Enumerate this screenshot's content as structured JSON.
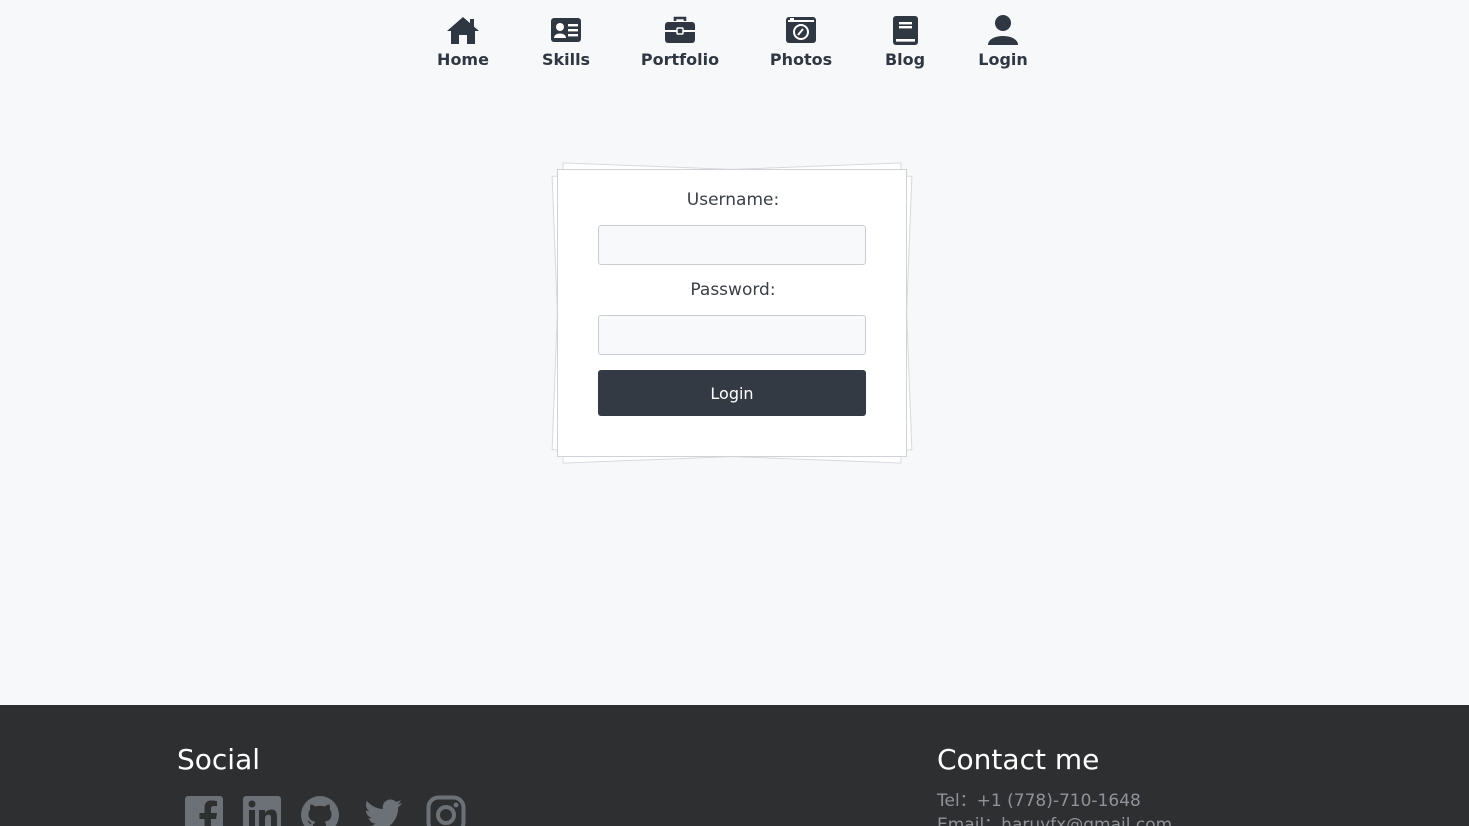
{
  "nav": {
    "items": [
      {
        "label": "Home",
        "icon": "home-icon"
      },
      {
        "label": "Skills",
        "icon": "id-card-icon"
      },
      {
        "label": "Portfolio",
        "icon": "briefcase-icon"
      },
      {
        "label": "Photos",
        "icon": "camera-icon"
      },
      {
        "label": "Blog",
        "icon": "book-icon"
      },
      {
        "label": "Login",
        "icon": "user-icon"
      }
    ]
  },
  "login_form": {
    "username_label": "Username:",
    "username_value": "",
    "password_label": "Password:",
    "password_value": "",
    "submit_label": "Login"
  },
  "footer": {
    "social_title": "Social",
    "social_icons": [
      "facebook-icon",
      "linkedin-icon",
      "github-icon",
      "twitter-icon",
      "instagram-icon"
    ],
    "contact_title": "Contact me",
    "tel": "Tel：+1 (778)-710-1648",
    "email": "Email：haruyfx@gmail.com"
  },
  "colors": {
    "page_background": "#f7f8fa",
    "nav_icon": "#2f3742",
    "button": "#343a44",
    "footer_background": "#2e2f30",
    "footer_muted_text": "#8f9399",
    "social_icon": "#6c7178"
  }
}
